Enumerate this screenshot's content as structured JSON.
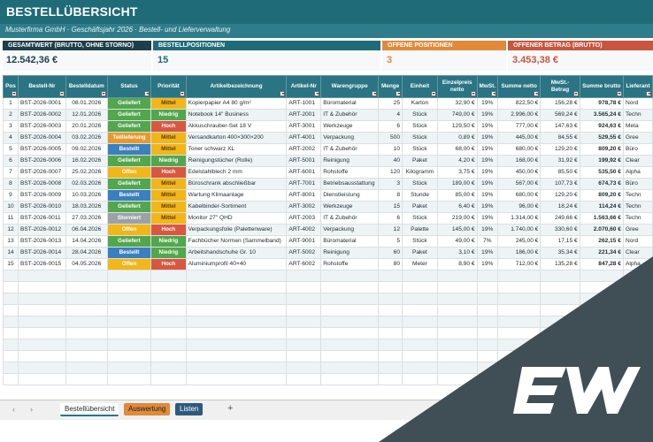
{
  "app": {
    "title": "BESTELLÜBERSICHT",
    "subtitle": "Musterfirma GmbH  ·  Geschäftsjahr 2026  ·  Bestell- und Lieferverwaltung"
  },
  "kpis": [
    {
      "label": "GESAMTWERT (BRUTTO, OHNE STORNO)",
      "value": "12.542,36 €",
      "color": "#1d3f4a"
    },
    {
      "label": "BESTELLPOSITIONEN",
      "value": "15",
      "color": "#1f6b78"
    },
    {
      "label": "OFFENE POSITIONEN",
      "value": "3",
      "color": "#e08a3a"
    },
    {
      "label": "OFFENER BETRAG (BRUTTO)",
      "value": "3.453,38 €",
      "color": "#c9553e"
    }
  ],
  "columns": [
    "Pos",
    "Bestell-Nr",
    "Bestelldatum",
    "Status",
    "Priorität",
    "Artikelbezeichnung",
    "Artikel-Nr",
    "Warengruppe",
    "Menge",
    "Einheit",
    "Einzelpreis netto",
    "MwSt.",
    "Summe netto",
    "MwSt.-Betrag",
    "Summe brutto",
    "Lieferant"
  ],
  "rows": [
    {
      "pos": "1",
      "nr": "BST-2026-0001",
      "datum": "08.01.2026",
      "status": "Geliefert",
      "prio": "Mittel",
      "artikel": "Kopierpapier A4 80 g/m²",
      "artnr": "ART-1001",
      "gruppe": "Büromaterial",
      "menge": "25",
      "einheit": "Karton",
      "preis": "32,90 €",
      "mwst": "19%",
      "netto": "822,50 €",
      "mwstb": "156,28 €",
      "brutto": "978,78 €",
      "lief": "Nord"
    },
    {
      "pos": "2",
      "nr": "BST-2026-0002",
      "datum": "12.01.2026",
      "status": "Geliefert",
      "prio": "Niedrig",
      "artikel": "Notebook 14\" Business",
      "artnr": "ART-2001",
      "gruppe": "IT & Zubehör",
      "menge": "4",
      "einheit": "Stück",
      "preis": "749,00 €",
      "mwst": "19%",
      "netto": "2.996,00 €",
      "mwstb": "569,24 €",
      "brutto": "3.565,24 €",
      "lief": "Techn"
    },
    {
      "pos": "3",
      "nr": "BST-2026-0003",
      "datum": "20.01.2026",
      "status": "Geliefert",
      "prio": "Hoch",
      "artikel": "Akkuschrauber-Set 18 V",
      "artnr": "ART-3001",
      "gruppe": "Werkzeuge",
      "menge": "6",
      "einheit": "Stück",
      "preis": "129,50 €",
      "mwst": "19%",
      "netto": "777,00 €",
      "mwstb": "147,63 €",
      "brutto": "924,63 €",
      "lief": "Meta"
    },
    {
      "pos": "4",
      "nr": "BST-2026-0004",
      "datum": "03.02.2026",
      "status": "Teillieferung",
      "prio": "Mittel",
      "artikel": "Versandkarton 400×300×200",
      "artnr": "ART-4001",
      "gruppe": "Verpackung",
      "menge": "500",
      "einheit": "Stück",
      "preis": "0,89 €",
      "mwst": "19%",
      "netto": "445,00 €",
      "mwstb": "84,55 €",
      "brutto": "529,55 €",
      "lief": "Gree"
    },
    {
      "pos": "5",
      "nr": "BST-2026-0005",
      "datum": "09.02.2026",
      "status": "Bestellt",
      "prio": "Mittel",
      "artikel": "Toner schwarz XL",
      "artnr": "ART-2002",
      "gruppe": "IT & Zubehör",
      "menge": "10",
      "einheit": "Stück",
      "preis": "68,00 €",
      "mwst": "19%",
      "netto": "680,00 €",
      "mwstb": "129,20 €",
      "brutto": "809,20 €",
      "lief": "Büro"
    },
    {
      "pos": "6",
      "nr": "BST-2026-0006",
      "datum": "16.02.2026",
      "status": "Geliefert",
      "prio": "Niedrig",
      "artikel": "Reinigungstücher (Rolle)",
      "artnr": "ART-5001",
      "gruppe": "Reinigung",
      "menge": "40",
      "einheit": "Paket",
      "preis": "4,20 €",
      "mwst": "19%",
      "netto": "168,00 €",
      "mwstb": "31,92 €",
      "brutto": "199,92 €",
      "lief": "Clear"
    },
    {
      "pos": "7",
      "nr": "BST-2026-0007",
      "datum": "25.02.2026",
      "status": "Offen",
      "prio": "Hoch",
      "artikel": "Edelstahlblech 2 mm",
      "artnr": "ART-6001",
      "gruppe": "Rohstoffe",
      "menge": "120",
      "einheit": "Kilogramm",
      "preis": "3,75 €",
      "mwst": "19%",
      "netto": "450,00 €",
      "mwstb": "85,50 €",
      "brutto": "535,50 €",
      "lief": "Alpha"
    },
    {
      "pos": "8",
      "nr": "BST-2026-0008",
      "datum": "02.03.2026",
      "status": "Geliefert",
      "prio": "Mittel",
      "artikel": "Büroschrank abschließbar",
      "artnr": "ART-7001",
      "gruppe": "Betriebsausstattung",
      "menge": "3",
      "einheit": "Stück",
      "preis": "189,00 €",
      "mwst": "19%",
      "netto": "567,00 €",
      "mwstb": "107,73 €",
      "brutto": "674,73 €",
      "lief": "Büro"
    },
    {
      "pos": "9",
      "nr": "BST-2026-0009",
      "datum": "10.03.2026",
      "status": "Bestellt",
      "prio": "Mittel",
      "artikel": "Wartung Klimaanlage",
      "artnr": "ART-8001",
      "gruppe": "Dienstleistung",
      "menge": "8",
      "einheit": "Stunde",
      "preis": "85,00 €",
      "mwst": "19%",
      "netto": "680,00 €",
      "mwstb": "129,20 €",
      "brutto": "809,20 €",
      "lief": "Techn"
    },
    {
      "pos": "10",
      "nr": "BST-2026-0010",
      "datum": "18.03.2026",
      "status": "Geliefert",
      "prio": "Mittel",
      "artikel": "Kabelbinder-Sortiment",
      "artnr": "ART-3002",
      "gruppe": "Werkzeuge",
      "menge": "15",
      "einheit": "Paket",
      "preis": "6,40 €",
      "mwst": "19%",
      "netto": "96,00 €",
      "mwstb": "18,24 €",
      "brutto": "114,24 €",
      "lief": "Techn"
    },
    {
      "pos": "11",
      "nr": "BST-2026-0011",
      "datum": "27.03.2026",
      "status": "Storniert",
      "prio": "Mittel",
      "artikel": "Monitor 27\" QHD",
      "artnr": "ART-2003",
      "gruppe": "IT & Zubehör",
      "menge": "6",
      "einheit": "Stück",
      "preis": "219,00 €",
      "mwst": "19%",
      "netto": "1.314,00 €",
      "mwstb": "249,66 €",
      "brutto": "1.563,66 €",
      "lief": "Techn"
    },
    {
      "pos": "12",
      "nr": "BST-2026-0012",
      "datum": "06.04.2026",
      "status": "Offen",
      "prio": "Hoch",
      "artikel": "Verpackungsfolie (Palettenware)",
      "artnr": "ART-4002",
      "gruppe": "Verpackung",
      "menge": "12",
      "einheit": "Palette",
      "preis": "145,00 €",
      "mwst": "19%",
      "netto": "1.740,00 €",
      "mwstb": "330,60 €",
      "brutto": "2.070,60 €",
      "lief": "Gree"
    },
    {
      "pos": "13",
      "nr": "BST-2026-0013",
      "datum": "14.04.2026",
      "status": "Geliefert",
      "prio": "Niedrig",
      "artikel": "Fachbücher Normen (Sammelband)",
      "artnr": "ART-9001",
      "gruppe": "Büromaterial",
      "menge": "5",
      "einheit": "Stück",
      "preis": "49,00 €",
      "mwst": "7%",
      "netto": "245,00 €",
      "mwstb": "17,15 €",
      "brutto": "262,15 €",
      "lief": "Nord"
    },
    {
      "pos": "14",
      "nr": "BST-2026-0014",
      "datum": "28.04.2026",
      "status": "Bestellt",
      "prio": "Niedrig",
      "artikel": "Arbeitshandschuhe Gr. 10",
      "artnr": "ART-5002",
      "gruppe": "Reinigung",
      "menge": "60",
      "einheit": "Paket",
      "preis": "3,10 €",
      "mwst": "19%",
      "netto": "186,00 €",
      "mwstb": "35,34 €",
      "brutto": "221,34 €",
      "lief": "Clear"
    },
    {
      "pos": "15",
      "nr": "BST-2026-0015",
      "datum": "04.05.2026",
      "status": "Offen",
      "prio": "Hoch",
      "artikel": "Aluminiumprofil 40×40",
      "artnr": "ART-6002",
      "gruppe": "Rohstoffe",
      "menge": "80",
      "einheit": "Meter",
      "preis": "8,90 €",
      "mwst": "19%",
      "netto": "712,00 €",
      "mwstb": "135,28 €",
      "brutto": "847,28 €",
      "lief": "Alpha"
    }
  ],
  "sheets": {
    "active": "Bestellübersicht",
    "second": "Auswertung",
    "third": "Listen",
    "add": "+"
  },
  "nav": {
    "prev": "‹",
    "next": "›"
  },
  "watermark": {
    "icon": "ex-logo-icon",
    "color": "#3f4f55"
  }
}
